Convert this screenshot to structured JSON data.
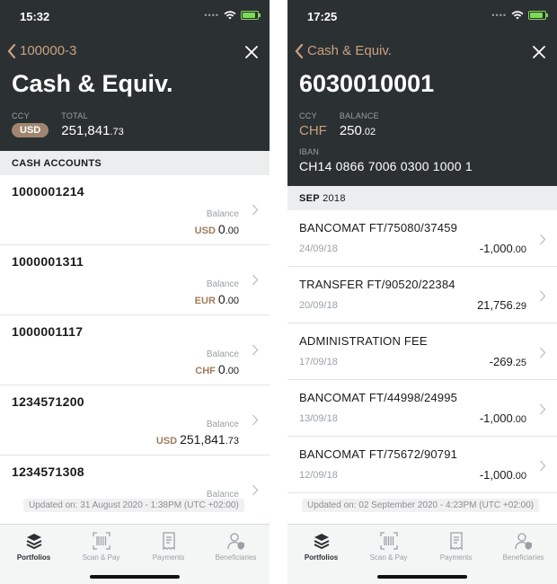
{
  "left": {
    "status_time": "15:32",
    "back_label": "100000-3",
    "title": "Cash & Equiv.",
    "ccy_label": "CCY",
    "ccy_value": "USD",
    "total_label": "TOTAL",
    "total_main": "251,841",
    "total_cents": ".73",
    "section_title": "CASH ACCOUNTS",
    "accounts": [
      {
        "number": "1000001214",
        "balance_label": "Balance",
        "ccy": "USD",
        "amount_main": "0",
        "amount_cents": ".00"
      },
      {
        "number": "1000001311",
        "balance_label": "Balance",
        "ccy": "EUR",
        "amount_main": "0",
        "amount_cents": ".00"
      },
      {
        "number": "1000001117",
        "balance_label": "Balance",
        "ccy": "CHF",
        "amount_main": "0",
        "amount_cents": ".00"
      },
      {
        "number": "1234571200",
        "balance_label": "Balance",
        "ccy": "USD",
        "amount_main": "251,841",
        "amount_cents": ".73"
      },
      {
        "number": "1234571308",
        "balance_label": "Balance",
        "ccy": "",
        "amount_main": "",
        "amount_cents": ""
      }
    ],
    "updated": "Updated on: 31 August 2020 - 1:38PM (UTC +02:00)"
  },
  "right": {
    "status_time": "17:25",
    "back_label": "Cash & Equiv.",
    "title": "6030010001",
    "ccy_label": "CCY",
    "ccy_value": "CHF",
    "balance_label": "BALANCE",
    "balance_main": "250",
    "balance_cents": ".02",
    "iban_label": "IBAN",
    "iban_value": "CH14 0866 7006 0300 1000 1",
    "section_month": "SEP",
    "section_year": "2018",
    "transactions": [
      {
        "desc": "BANCOMAT FT/75080/37459",
        "date": "24/09/18",
        "amount_main": "-1,000",
        "amount_cents": ".00"
      },
      {
        "desc": "TRANSFER FT/90520/22384",
        "date": "20/09/18",
        "amount_main": "21,756",
        "amount_cents": ".29"
      },
      {
        "desc": "ADMINISTRATION FEE",
        "date": "17/09/18",
        "amount_main": "-269",
        "amount_cents": ".25"
      },
      {
        "desc": "BANCOMAT FT/44998/24995",
        "date": "13/09/18",
        "amount_main": "-1,000",
        "amount_cents": ".00"
      },
      {
        "desc": "BANCOMAT FT/75672/90791",
        "date": "12/09/18",
        "amount_main": "-1,000",
        "amount_cents": ".00"
      }
    ],
    "updated": "Updated on: 02 September 2020 - 4:23PM (UTC +02:00)"
  },
  "tabs": [
    {
      "label": "Portfolios",
      "icon": "layers-icon",
      "active": true
    },
    {
      "label": "Scan & Pay",
      "icon": "barcode-scan-icon",
      "active": false
    },
    {
      "label": "Payments",
      "icon": "receipt-icon",
      "active": false
    },
    {
      "label": "Beneficiaries",
      "icon": "user-shield-icon",
      "active": false
    }
  ],
  "colors": {
    "header_bg": "#2b3033",
    "accent": "#c9a17f",
    "badge": "#a08670",
    "battery": "#7ed957"
  }
}
